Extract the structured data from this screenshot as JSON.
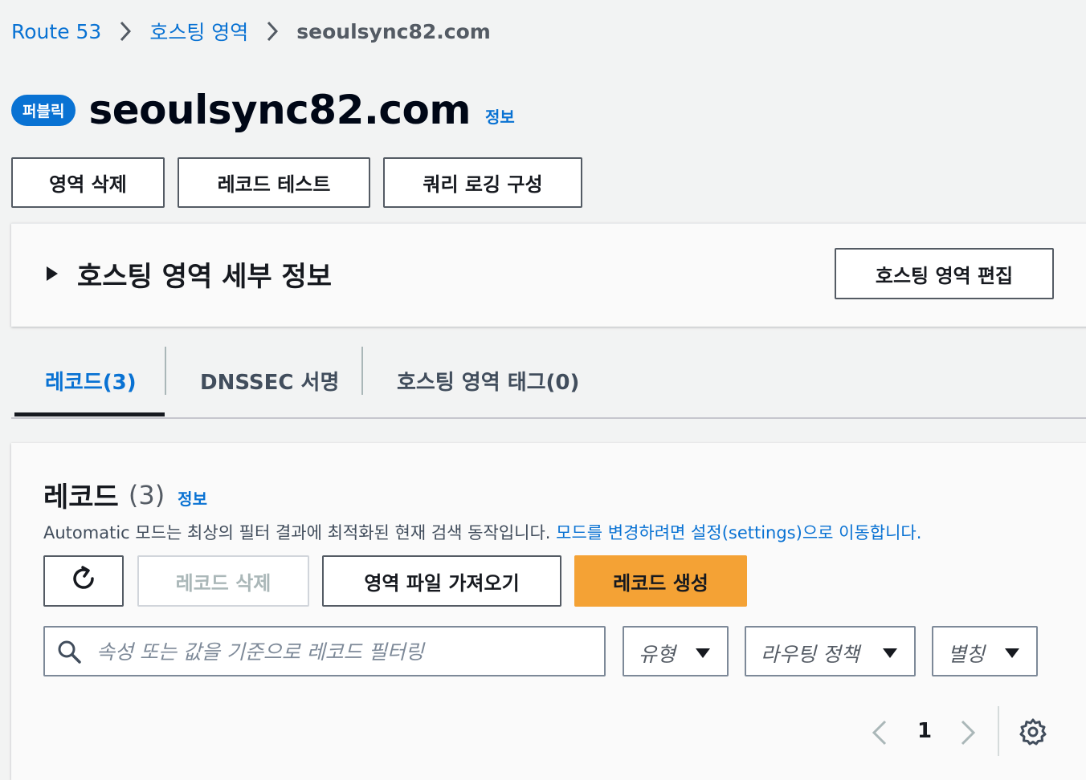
{
  "breadcrumb": {
    "items": [
      "Route 53",
      "호스팅 영역"
    ],
    "current": "seoulsync82.com"
  },
  "header": {
    "badge": "퍼블릭",
    "title": "seoulsync82.com",
    "info": "정보"
  },
  "actions": {
    "delete_zone": "영역 삭제",
    "test_record": "레코드 테스트",
    "query_logging": "쿼리 로깅 구성"
  },
  "details_panel": {
    "title": "호스팅 영역 세부 정보",
    "edit_button": "호스팅 영역 편집"
  },
  "tabs": [
    {
      "label": "레코드(3)",
      "active": true
    },
    {
      "label": "DNSSEC 서명",
      "active": false
    },
    {
      "label": "호스팅 영역 태그(0)",
      "active": false
    }
  ],
  "records": {
    "title": "레코드",
    "count": "(3)",
    "info": "정보",
    "description": "Automatic 모드는 최상의 필터 결과에 최적화된 현재 검색 동작입니다. ",
    "description_link": "모드를 변경하려면 설정(settings)으로 이동합니다.",
    "buttons": {
      "delete": "레코드 삭제",
      "import": "영역 파일 가져오기",
      "create": "레코드 생성"
    },
    "search_placeholder": "속성 또는 값을 기준으로 레코드 필터링",
    "filters": [
      "유형",
      "라우팅 정책",
      "별칭"
    ],
    "pagination": {
      "current_page": "1"
    }
  },
  "colors": {
    "link": "#0972d3",
    "primary_button": "#f4a235",
    "background": "#f2f3f3"
  },
  "icons": [
    "chevron-right-icon",
    "caret-right-icon",
    "refresh-icon",
    "search-icon",
    "caret-down-icon",
    "chevron-left-icon",
    "gear-icon"
  ]
}
